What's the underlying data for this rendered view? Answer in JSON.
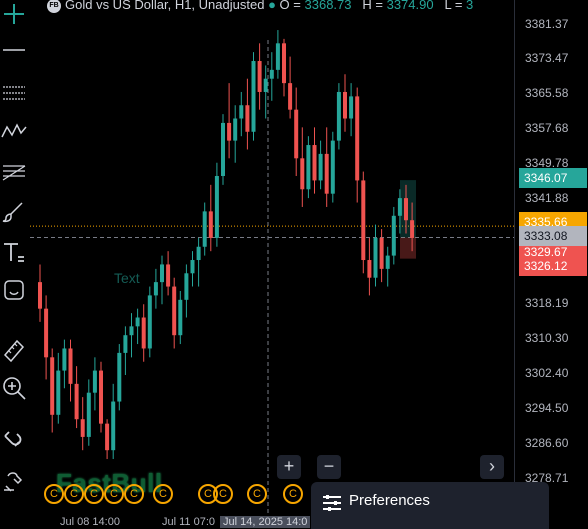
{
  "chart_title": {
    "badge": "FB",
    "symbol_text": "Gold vs US Dollar, H1, Unadjusted",
    "open_label": "O",
    "open_value": "3368.73",
    "high_label": "H",
    "high_value": "3374.90",
    "low_label": "L",
    "low_value": "3"
  },
  "toolbar": {
    "tools": [
      "crosshair-icon",
      "horizontal-line-icon",
      "parallel-channel-icon",
      "pattern-icon",
      "fib-retracement-icon",
      "brush-icon",
      "text-tool-icon",
      "emoji-icon",
      "ruler-icon",
      "zoom-in-icon",
      "magnet-icon",
      "lock-icon"
    ]
  },
  "price_axis": {
    "ticks": [
      "3381.37",
      "3373.47",
      "3365.58",
      "3357.68",
      "3349.78",
      "3341.88",
      "3318.19",
      "3310.30",
      "3302.40",
      "3294.50",
      "3286.60",
      "3278.71"
    ],
    "labels": {
      "green": "3346.07",
      "orange": "3335.66",
      "gray": "3333.08",
      "red1": "3329.67",
      "red2": "3326.12"
    }
  },
  "time_axis": {
    "labels": [
      "Jul 08 14:00",
      "Jul 11 07:0",
      "Jul 14",
      "2025 14:0",
      "0"
    ],
    "crosshair_label": "Jul 14, 2025 14:0"
  },
  "annotation": {
    "text": "Text"
  },
  "watermark": {
    "text": "FastBull"
  },
  "events": {
    "symbol": "C",
    "count": 9
  },
  "controls": {
    "zoom_in": "+",
    "zoom_out": "−",
    "scroll_right": "›"
  },
  "preferences": {
    "label": "Preferences"
  },
  "colors": {
    "up": "#26a69a",
    "down": "#ef5350",
    "background": "#000000",
    "accent_orange": "#f7a600"
  },
  "chart_data": {
    "type": "candlestick",
    "y_axis_ticks": [
      3381.37,
      3373.47,
      3365.58,
      3357.68,
      3349.78,
      3341.88,
      3318.19,
      3310.3,
      3302.4,
      3294.5,
      3286.6,
      3278.71
    ],
    "ylim": [
      3277,
      3384
    ],
    "ohlc": [
      [
        3323,
        3327,
        3314,
        3317
      ],
      [
        3317,
        3320,
        3301,
        3306
      ],
      [
        3306,
        3308,
        3289,
        3293
      ],
      [
        3293,
        3307,
        3291,
        3303
      ],
      [
        3303,
        3310,
        3299,
        3308
      ],
      [
        3308,
        3310,
        3296,
        3300
      ],
      [
        3300,
        3304,
        3290,
        3292
      ],
      [
        3292,
        3297,
        3285,
        3288
      ],
      [
        3288,
        3301,
        3286,
        3298
      ],
      [
        3298,
        3306,
        3294,
        3303
      ],
      [
        3303,
        3305,
        3289,
        3291
      ],
      [
        3291,
        3292,
        3283,
        3285
      ],
      [
        3285,
        3300,
        3283,
        3296
      ],
      [
        3296,
        3309,
        3294,
        3307
      ],
      [
        3307,
        3313,
        3302,
        3311
      ],
      [
        3311,
        3316,
        3306,
        3313
      ],
      [
        3313,
        3317,
        3309,
        3315
      ],
      [
        3315,
        3318,
        3305,
        3308
      ],
      [
        3308,
        3322,
        3306,
        3320
      ],
      [
        3320,
        3326,
        3317,
        3323
      ],
      [
        3323,
        3329,
        3318,
        3327
      ],
      [
        3327,
        3330,
        3320,
        3322
      ],
      [
        3322,
        3324,
        3308,
        3311
      ],
      [
        3311,
        3321,
        3309,
        3319
      ],
      [
        3319,
        3327,
        3315,
        3325
      ],
      [
        3325,
        3330,
        3322,
        3328
      ],
      [
        3328,
        3333,
        3322,
        3331
      ],
      [
        3331,
        3341,
        3329,
        3339
      ],
      [
        3339,
        3345,
        3330,
        3333
      ],
      [
        3333,
        3350,
        3331,
        3347
      ],
      [
        3347,
        3361,
        3345,
        3359
      ],
      [
        3359,
        3368,
        3351,
        3355
      ],
      [
        3355,
        3363,
        3350,
        3360
      ],
      [
        3360,
        3366,
        3356,
        3363
      ],
      [
        3363,
        3369,
        3353,
        3357
      ],
      [
        3357,
        3375,
        3355,
        3373
      ],
      [
        3373,
        3377,
        3362,
        3366
      ],
      [
        3366,
        3372,
        3360,
        3369
      ],
      [
        3369,
        3375,
        3364,
        3371
      ],
      [
        3371,
        3380,
        3369,
        3377
      ],
      [
        3377,
        3378,
        3365,
        3368
      ],
      [
        3368,
        3374,
        3360,
        3362
      ],
      [
        3362,
        3367,
        3347,
        3351
      ],
      [
        3351,
        3358,
        3340,
        3344
      ],
      [
        3344,
        3356,
        3342,
        3354
      ],
      [
        3354,
        3358,
        3343,
        3346
      ],
      [
        3346,
        3355,
        3344,
        3352
      ],
      [
        3352,
        3358,
        3340,
        3343
      ],
      [
        3343,
        3357,
        3341,
        3355
      ],
      [
        3355,
        3368,
        3353,
        3366
      ],
      [
        3366,
        3370,
        3357,
        3360
      ],
      [
        3360,
        3368,
        3356,
        3365
      ],
      [
        3365,
        3367,
        3341,
        3346
      ],
      [
        3346,
        3348,
        3325,
        3328
      ],
      [
        3328,
        3333,
        3320,
        3324
      ],
      [
        3324,
        3336,
        3322,
        3333
      ],
      [
        3333,
        3335,
        3323,
        3326
      ],
      [
        3326,
        3331,
        3322,
        3329
      ],
      [
        3329,
        3340,
        3327,
        3338
      ],
      [
        3338,
        3344,
        3334,
        3342
      ],
      [
        3342,
        3345,
        3334,
        3337
      ],
      [
        3337,
        3341,
        3330,
        3333
      ]
    ],
    "crosshair_price": 3333.08,
    "orange_level": 3335.66
  }
}
